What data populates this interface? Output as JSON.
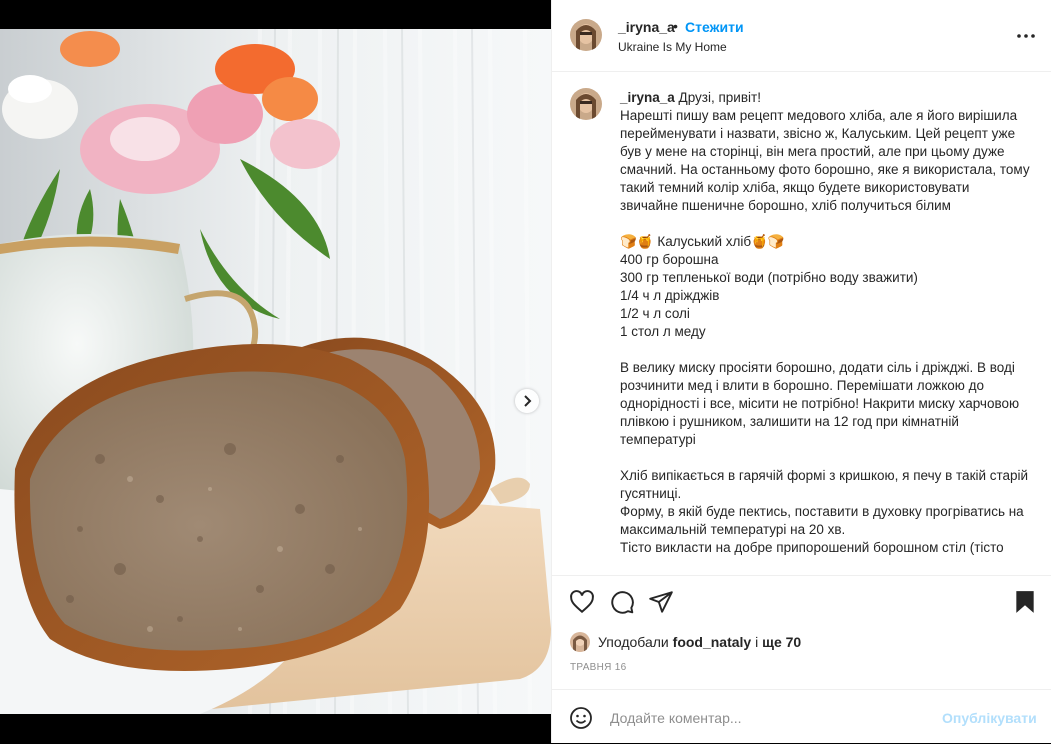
{
  "post": {
    "username": "_iryna_a",
    "separator": "•",
    "follow_label": "Стежити",
    "location": "Ukraine Is My Home",
    "more_icon": "more-horizontal-icon",
    "next_icon": "chevron-right-icon",
    "carousel": {
      "count": 5,
      "active_index": 0
    }
  },
  "caption": {
    "username": "_iryna_a",
    "text": " Друзі, привіт!\nНарешті пишу вам рецепт медового хліба, але я його вирішила перейменувати і назвати, звісно ж, Калуським. Цей рецепт уже був у мене на сторінці, він мега простий, але при цьому дуже смачний. На останньому фото борошно, яке я використала, тому такий темний колір хліба, якщо будете використовувати звичайне пшеничне борошно, хліб получиться білим\n\n🍞🍯 Калуський хліб🍯🍞\n400 гр борошна\n300 гр тепленької води (потрібно воду зважити)\n1/4 ч л дріжджів\n1/2 ч л солі\n1 стол л меду\n\nВ велику миску просіяти борошно, додати сіль і дріжджі. В воді розчинити мед і влити в борошно. Перемішати ложкою до однорідності і все, місити не потрібно! Накрити миску харчовою плівкою і рушником, залишити на 12 год при кімнатній температурі\n\nХліб випікається в гарячій формі з кришкою, я печу в такій старій гусятниці.\nФорму, в якій буде пектись, поставити в духовку прогріватись на максимальній температурі на 20 хв.\nТісто викласти на добре припорошений борошном стіл (тісто"
  },
  "actions": {
    "like_icon": "heart-icon",
    "comment_icon": "comment-icon",
    "share_icon": "share-icon",
    "save_icon": "bookmark-icon"
  },
  "likes": {
    "prefix": "Уподобали",
    "user": "food_nataly",
    "conj": "і",
    "more": "ще 70"
  },
  "date": "ТРАВНЯ 16",
  "comment": {
    "emoji_icon": "emoji-icon",
    "placeholder": "Додайте коментар...",
    "publish_label": "Опублікувати"
  },
  "colors": {
    "accent": "#0095f6",
    "publish_disabled": "#b2dffc",
    "muted": "#8e8e8e",
    "border": "#efefef"
  }
}
